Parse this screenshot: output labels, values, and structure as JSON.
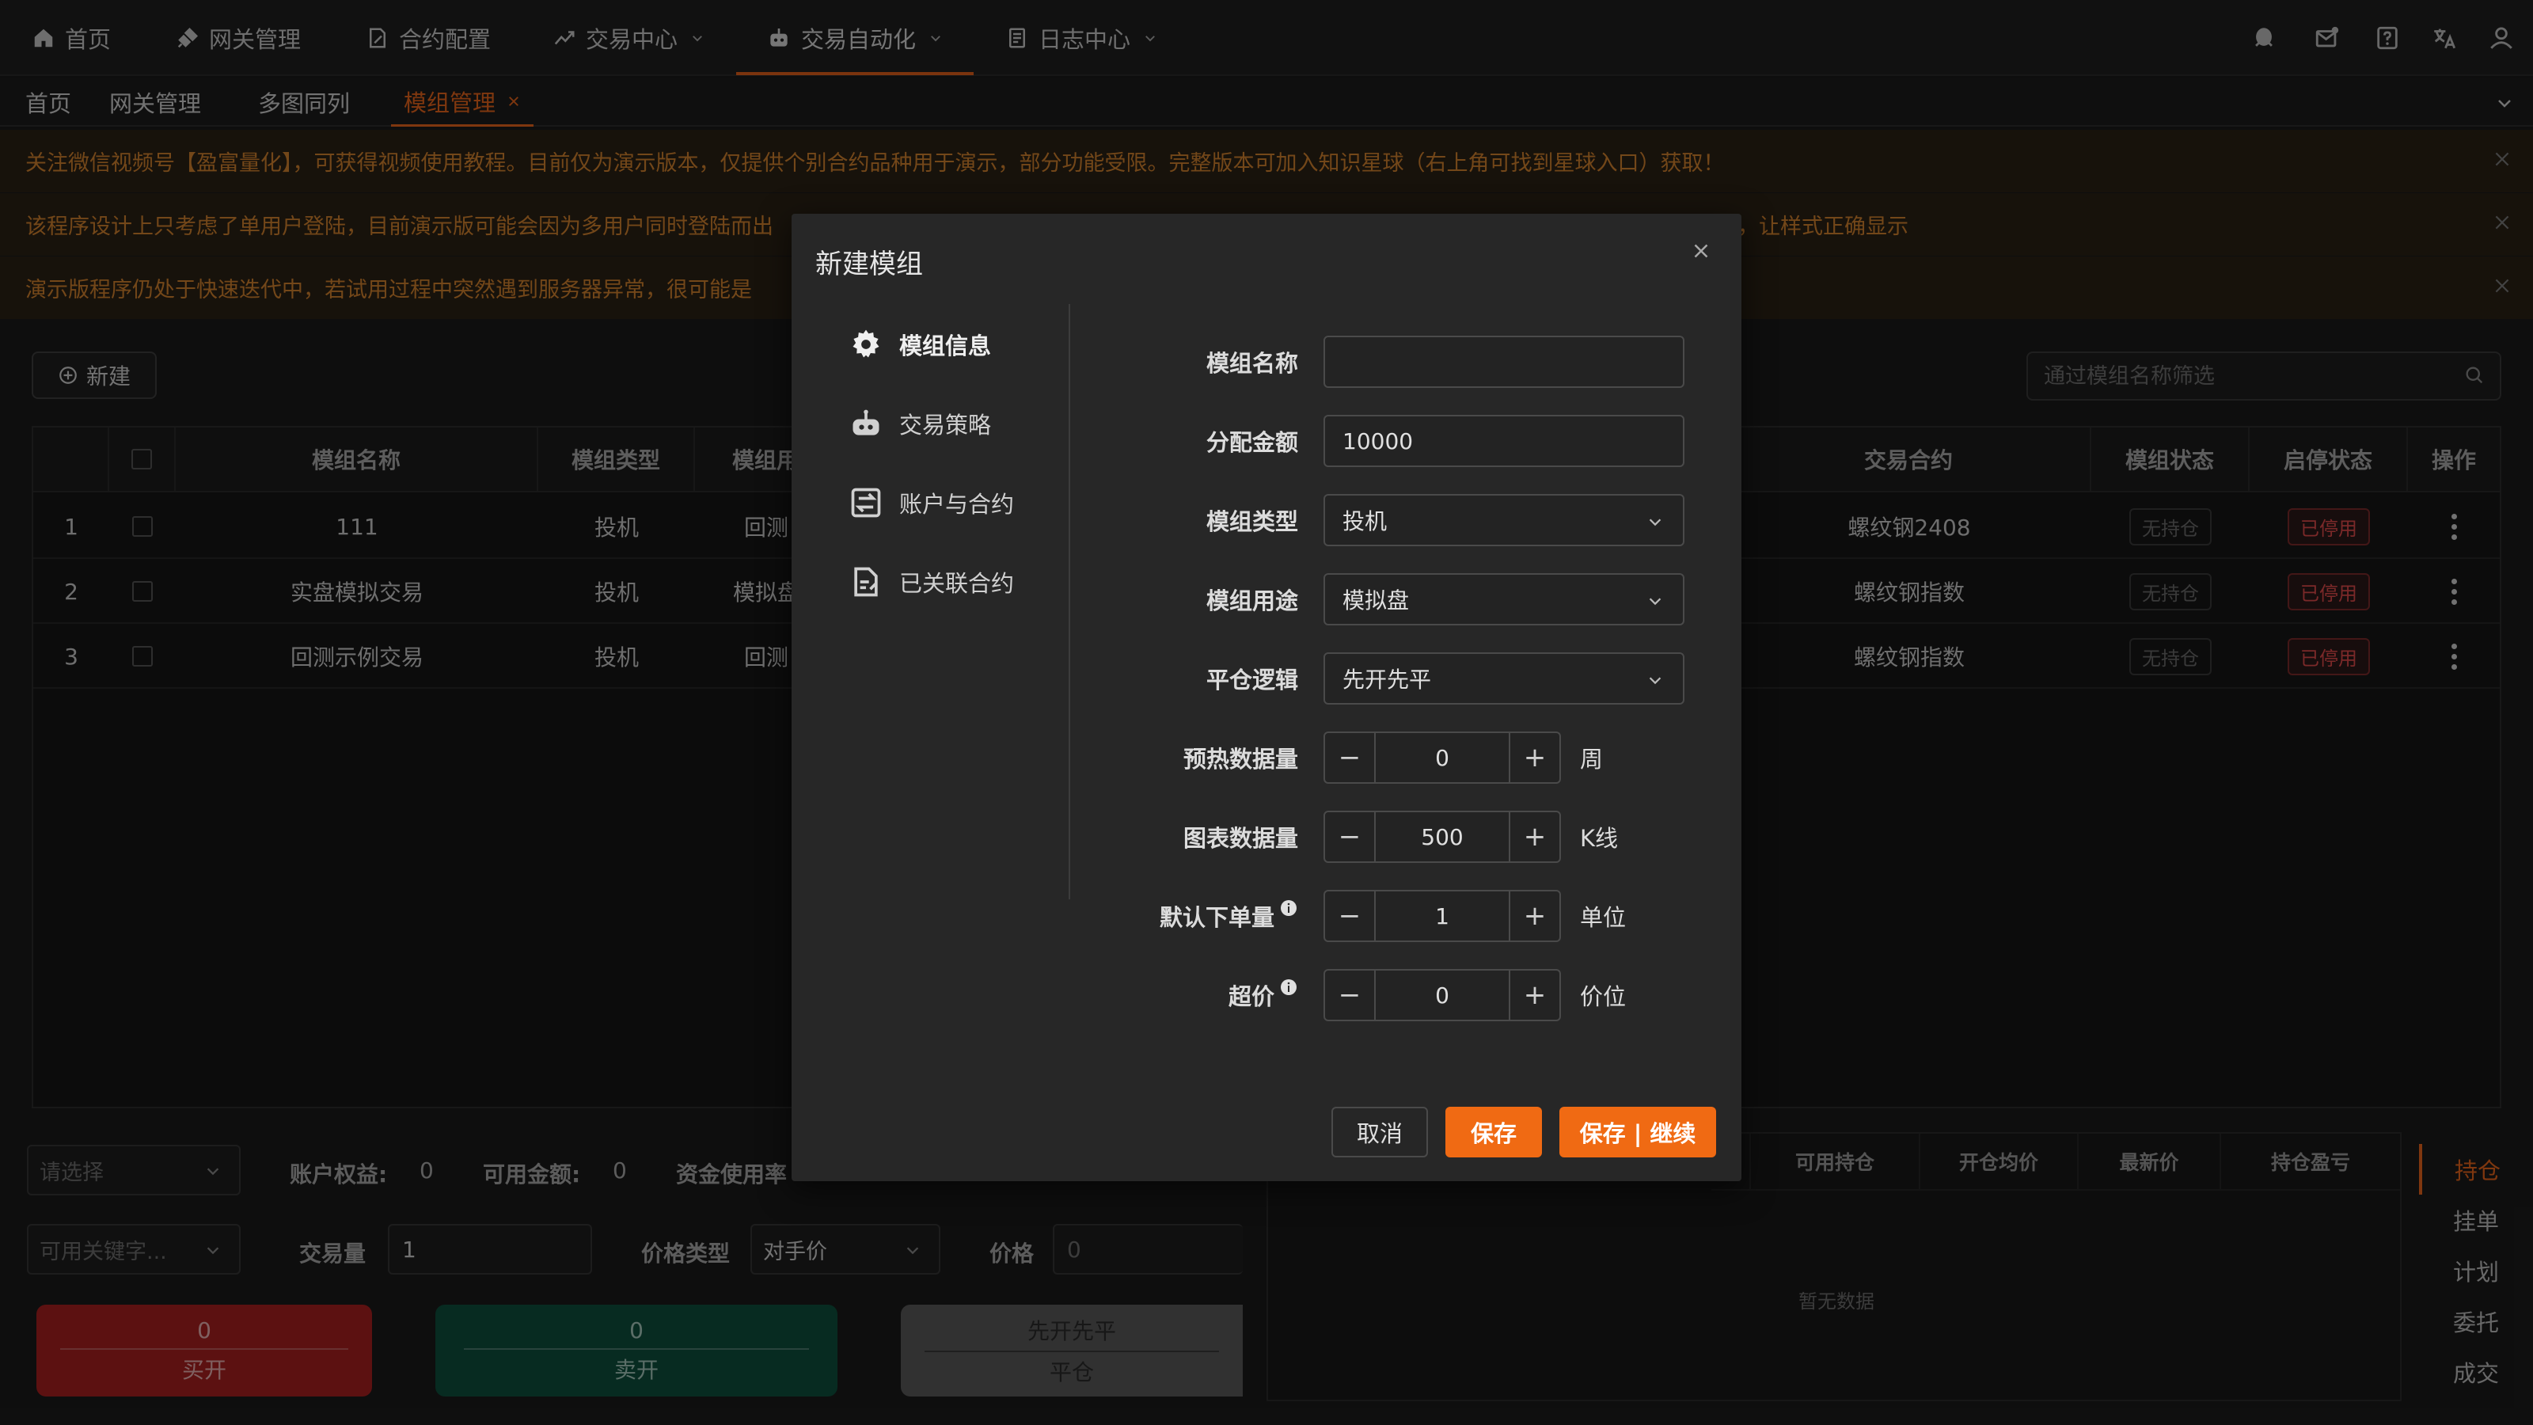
{
  "nav": {
    "items": [
      {
        "label": "首页",
        "icon": "home-icon"
      },
      {
        "label": "网关管理",
        "icon": "plug-icon"
      },
      {
        "label": "合约配置",
        "icon": "document-edit-icon"
      },
      {
        "label": "交易中心",
        "icon": "trend-icon"
      },
      {
        "label": "交易自动化",
        "icon": "robot-icon"
      },
      {
        "label": "日志中心",
        "icon": "log-icon"
      }
    ],
    "header_icons": [
      "qq-icon",
      "mail-icon",
      "help-icon",
      "translate-icon",
      "user-icon"
    ]
  },
  "tabs": [
    {
      "label": "首页"
    },
    {
      "label": "网关管理"
    },
    {
      "label": "多图同列"
    },
    {
      "label": "模组管理"
    }
  ],
  "notices": [
    "关注微信视频号【盈富量化】，可获得视频使用教程。目前仅为演示版本，仅提供个别合约品种用于演示，部分功能受限。完整版本可加入知识星球（右上角可找到星球入口）获取！",
    "该程序设计上只考虑了单用户登陆，目前演示版可能会因为多用户同时登陆而出",
    "演示版程序仍处于快速迭代中，若试用过程中突然遇到服务器异常，很可能是"
  ],
  "notice_tail": "示，让样式正确显示",
  "toolbar": {
    "new_label": "新建",
    "search_placeholder": "通过模组名称筛选"
  },
  "table": {
    "headers": [
      "模组名称",
      "模组类型",
      "模组用",
      "交易合约",
      "模组状态",
      "启停状态",
      "操作"
    ],
    "rows": [
      {
        "idx": "1",
        "name": "111",
        "type": "投机",
        "usage": "回测",
        "contract": "螺纹钢2408",
        "status": "无持仓",
        "state": "已停用"
      },
      {
        "idx": "2",
        "name": "实盘模拟交易",
        "type": "投机",
        "usage": "模拟盘",
        "contract": "螺纹钢指数",
        "status": "无持仓",
        "state": "已停用"
      },
      {
        "idx": "3",
        "name": "回测示例交易",
        "type": "投机",
        "usage": "回测",
        "contract": "螺纹钢指数",
        "status": "无持仓",
        "state": "已停用"
      }
    ]
  },
  "bottom": {
    "account_placeholder": "请选择",
    "equity_label": "账户权益:",
    "equity_value": "0",
    "available_label": "可用金额:",
    "available_value": "0",
    "usage_label": "资金使用率",
    "keyword_placeholder": "可用关键字...",
    "volume_label": "交易量",
    "volume_value": "1",
    "price_type_label": "价格类型",
    "price_type_value": "对手价",
    "price_label": "价格",
    "price_placeholder": "0",
    "buy_top": "0",
    "buy_label": "买开",
    "sell_top": "0",
    "sell_label": "卖开",
    "close_top": "先开先平",
    "close_label": "平仓",
    "position_headers": [
      "仓",
      "可用持仓",
      "开仓均价",
      "最新价",
      "持仓盈亏"
    ],
    "empty_text": "暂无数据",
    "side_tabs": [
      "持仓",
      "挂单",
      "计划",
      "委托",
      "成交"
    ]
  },
  "modal": {
    "title": "新建模组",
    "nav": [
      {
        "label": "模组信息",
        "icon": "gear-icon"
      },
      {
        "label": "交易策略",
        "icon": "robot-icon"
      },
      {
        "label": "账户与合约",
        "icon": "exchange-icon"
      },
      {
        "label": "已关联合约",
        "icon": "document-link-icon"
      }
    ],
    "fields": {
      "name_label": "模组名称",
      "name_value": "",
      "amount_label": "分配金额",
      "amount_value": "10000",
      "type_label": "模组类型",
      "type_value": "投机",
      "usage_label": "模组用途",
      "usage_value": "模拟盘",
      "close_label": "平仓逻辑",
      "close_value": "先开先平",
      "warmup_label": "预热数据量",
      "warmup_value": "0",
      "warmup_unit": "周",
      "chart_label": "图表数据量",
      "chart_value": "500",
      "chart_unit": "K线",
      "order_label": "默认下单量",
      "order_value": "1",
      "order_unit": "单位",
      "slip_label": "超价",
      "slip_value": "0",
      "slip_unit": "价位"
    },
    "buttons": {
      "cancel": "取消",
      "save": "保存",
      "save_continue": "保存 | 继续"
    }
  },
  "colors": {
    "accent": "#f06a13",
    "danger": "#e04c4c",
    "buy": "#a82020",
    "sell": "#0d4f3c"
  }
}
